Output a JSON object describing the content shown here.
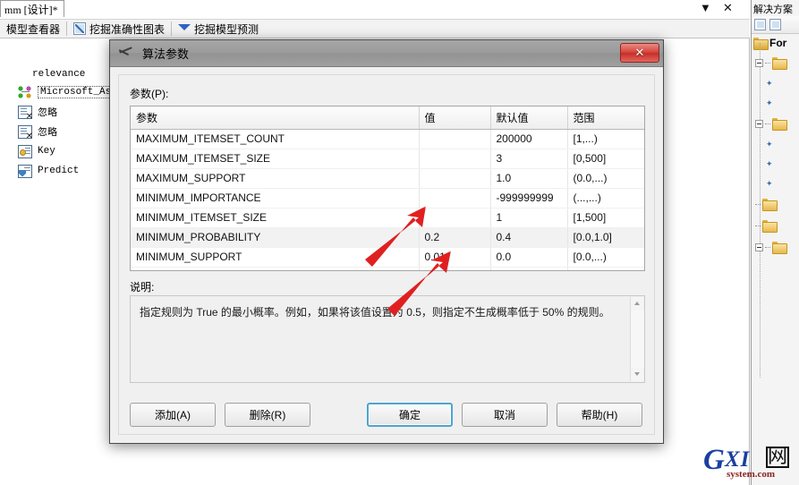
{
  "ide": {
    "document_tab": "mm [设计]*",
    "tabstrip_controls": [
      {
        "name": "chevron-down-icon",
        "glyph": "▼"
      },
      {
        "name": "close-icon",
        "glyph": "✕"
      }
    ],
    "toolbar": [
      {
        "label": "模型查看器",
        "icon": "none"
      },
      {
        "label": "挖掘准确性图表",
        "icon": "chart-icon"
      },
      {
        "label": "挖掘模型预测",
        "icon": "diamond-icon"
      }
    ],
    "column_list": {
      "header": "relevance",
      "items": [
        {
          "label": "Microsoft_Ass",
          "icon": "association-icon",
          "selected": true
        },
        {
          "label": "忽略",
          "icon": "ignore-icon",
          "selected": false
        },
        {
          "label": "忽略",
          "icon": "ignore-icon",
          "selected": false
        },
        {
          "label": "Key",
          "icon": "key-icon",
          "selected": false
        },
        {
          "label": "Predict",
          "icon": "predict-icon",
          "selected": false
        }
      ]
    }
  },
  "solution_explorer": {
    "title": "解决方案",
    "root_label": "For",
    "toolbar_icons": [
      "properties-icon",
      "refresh-icon"
    ],
    "folders": [
      {
        "expander": true,
        "stars": 2
      },
      {
        "expander": true,
        "stars": 3
      },
      {
        "expander": false,
        "stars": 0
      },
      {
        "expander": false,
        "stars": 0
      },
      {
        "expander": true,
        "stars": 0
      }
    ]
  },
  "dialog": {
    "title": "算法参数",
    "icon": "pickaxe-icon",
    "close_label": "✕",
    "param_label": "参数(P):",
    "table": {
      "headers": [
        "参数",
        "值",
        "默认值",
        "范围"
      ],
      "rows": [
        {
          "name": "MAXIMUM_ITEMSET_COUNT",
          "value": "",
          "default": "200000",
          "range": "[1,...)",
          "highlight": false
        },
        {
          "name": "MAXIMUM_ITEMSET_SIZE",
          "value": "",
          "default": "3",
          "range": "[0,500]",
          "highlight": false
        },
        {
          "name": "MAXIMUM_SUPPORT",
          "value": "",
          "default": "1.0",
          "range": "(0.0,...)",
          "highlight": false
        },
        {
          "name": "MINIMUM_IMPORTANCE",
          "value": "",
          "default": "-999999999",
          "range": "(...,...)",
          "highlight": false
        },
        {
          "name": "MINIMUM_ITEMSET_SIZE",
          "value": "",
          "default": "1",
          "range": "[1,500]",
          "highlight": false
        },
        {
          "name": "MINIMUM_PROBABILITY",
          "value": "0.2",
          "default": "0.4",
          "range": "[0.0,1.0]",
          "highlight": true
        },
        {
          "name": "MINIMUM_SUPPORT",
          "value": "0.01",
          "default": "0.0",
          "range": "[0.0,...)",
          "highlight": false
        }
      ]
    },
    "description_label": "说明:",
    "description_text": "指定规则为 True 的最小概率。例如，如果将该值设置为 0.5，则指定不生成概率低于 50% 的规则。",
    "scrollbar": {
      "up": "▲",
      "down": "▼"
    },
    "buttons": [
      {
        "label": "添加(A)",
        "accel": "A",
        "focused": false
      },
      {
        "label": "删除(R)",
        "accel": "R",
        "focused": false
      },
      {
        "label": "确定",
        "accel": "",
        "focused": true
      },
      {
        "label": "取消",
        "accel": "",
        "focused": false
      },
      {
        "label": "帮助(H)",
        "accel": "H",
        "focused": false
      }
    ],
    "annotations": [
      {
        "name": "arrow-to-minimum-probability-value",
        "color": "#e02020"
      },
      {
        "name": "arrow-to-minimum-support-value",
        "color": "#e02020"
      }
    ]
  },
  "watermark": {
    "g": "G",
    "xi": "XI",
    "net": "网",
    "system": "system.com"
  },
  "colors": {
    "accent_focus": "#4ca6cf",
    "close_red": "#d6433b",
    "annotation_red": "#e02020",
    "folder_yellow": "#e3b23c"
  }
}
